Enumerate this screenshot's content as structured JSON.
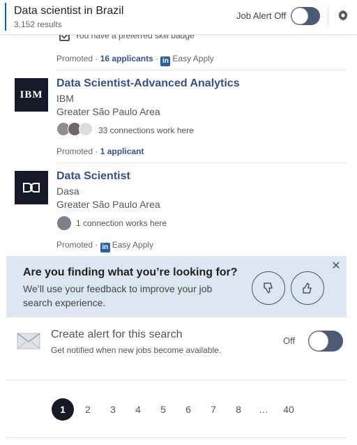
{
  "header": {
    "title": "Data scientist in Brazil",
    "results": "3,152 results",
    "job_alert_label": "Job Alert Off",
    "settings_icon": "gear-icon"
  },
  "partial_card": {
    "skill_badge": "You have a preferred skill badge",
    "promoted": "Promoted ·",
    "applicants": "16 applicants",
    "separator": "·",
    "easy_apply": "Easy Apply"
  },
  "jobs": [
    {
      "logo_text": "IBM",
      "title": "Data Scientist-Advanced Analytics",
      "company": "IBM",
      "location": "Greater São Paulo Area",
      "connections": "33 connections work here",
      "promoted": "Promoted ·",
      "applicants": "1 applicant"
    },
    {
      "logo_text": "Dasa",
      "title": "Data Scientist",
      "company": "Dasa",
      "location": "Greater São Paulo Area",
      "connections": "1 connection works here",
      "promoted": "Promoted ·",
      "easy_apply": "Easy Apply"
    }
  ],
  "feedback": {
    "question": "Are you finding what you’re looking for?",
    "subtitle": "We’ll use your feedback to improve your job search experience.",
    "thumbs_down_icon": "thumbs-down-icon",
    "thumbs_up_icon": "thumbs-up-icon",
    "close_icon": "close-icon"
  },
  "create_alert": {
    "title": "Create alert for this search",
    "subtitle": "Get notified when new jobs become available.",
    "state": "Off",
    "icon": "envelope-icon"
  },
  "pagination": {
    "pages": [
      "1",
      "2",
      "3",
      "4",
      "5",
      "6",
      "7",
      "8",
      "…",
      "40"
    ],
    "current": "1"
  },
  "colors": {
    "accent": "#34518c",
    "toggle": "#4c5b73",
    "feedback_bg": "#dce6f0",
    "logo_bg": "#161a26"
  }
}
